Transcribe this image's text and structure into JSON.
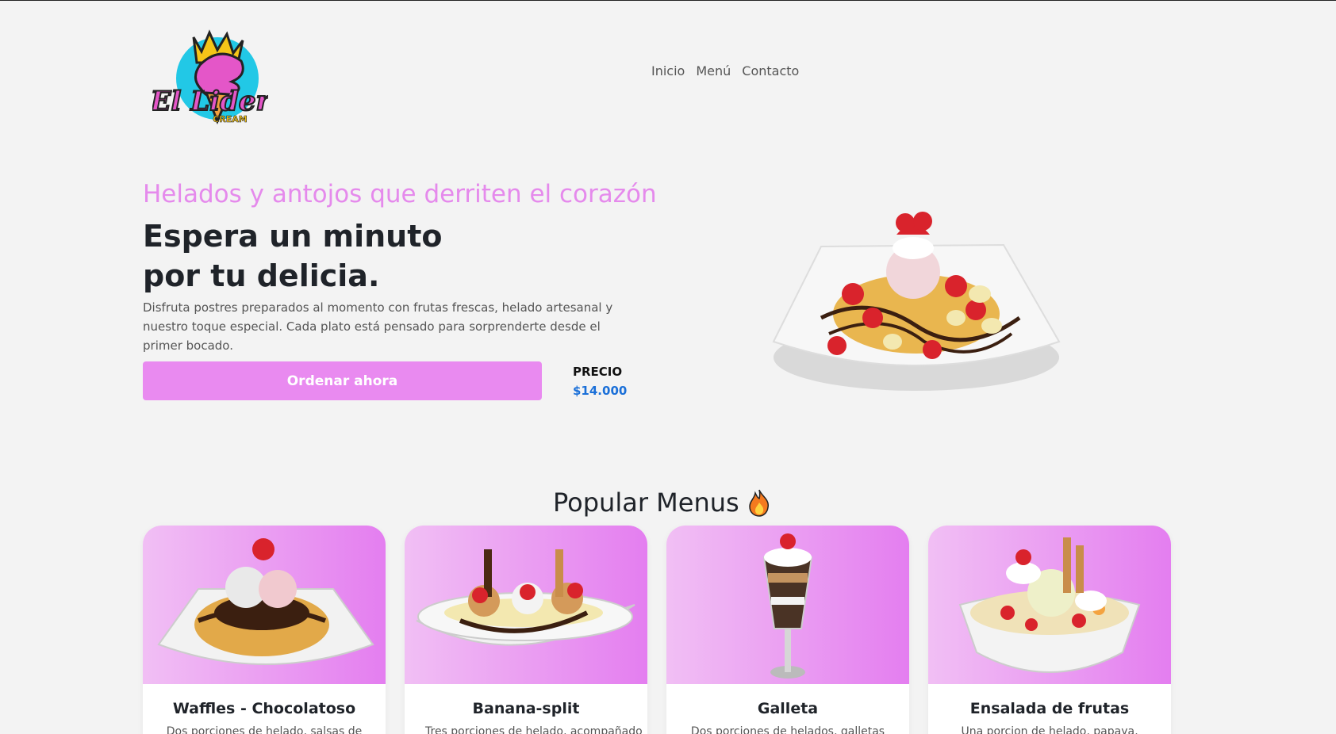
{
  "brand": {
    "logo_text": "El Lider",
    "logo_sub": "CREAM"
  },
  "nav": {
    "items": [
      "Inicio",
      "Menú",
      "Contacto"
    ]
  },
  "hero": {
    "subtitle": "Helados y antojos que derriten el corazón",
    "title_line1": "Espera un minuto",
    "title_line2": "por tu delicia.",
    "description": "Disfruta postres preparados al momento con frutas frescas, helado artesanal y nuestro toque especial. Cada plato está pensado para sorprenderte desde el primer bocado.",
    "order_button": "Ordenar ahora",
    "price_label": "PRECIO",
    "price_value": "$14.000"
  },
  "popular": {
    "title": "Popular Menus",
    "icon": "fire-icon",
    "cards": [
      {
        "title": "Waffles - Chocolatoso",
        "desc": "Dos porciones de helado, salsas de"
      },
      {
        "title": "Banana-split",
        "desc": "Tres porciones de helado, acompañado"
      },
      {
        "title": "Galleta",
        "desc": "Dos porciones de helados, galletas"
      },
      {
        "title": "Ensalada de frutas",
        "desc": "Una porcion de helado, papaya,"
      }
    ]
  },
  "colors": {
    "accent": "#e98af0",
    "subtitle": "#e58aec",
    "price": "#1a6fd8",
    "background": "#f3f3f3"
  }
}
